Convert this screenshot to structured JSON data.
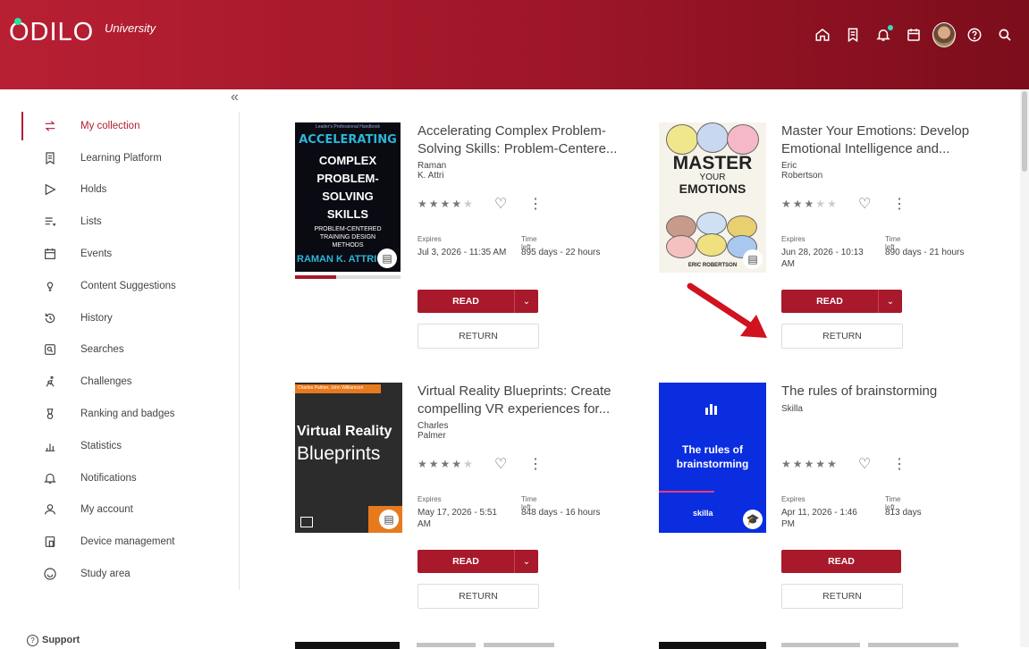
{
  "header": {
    "logo": "ODILO",
    "logo_sub": "University",
    "icons": [
      "home-icon",
      "bookmark-icon",
      "bell-icon",
      "calendar-icon",
      "avatar",
      "help-icon",
      "search-icon"
    ]
  },
  "sidebar": {
    "collapse": "«",
    "items": [
      {
        "label": "My collection",
        "icon": "swap-icon"
      },
      {
        "label": "Learning Platform",
        "icon": "bookmark-icon"
      },
      {
        "label": "Holds",
        "icon": "flag-icon"
      },
      {
        "label": "Lists",
        "icon": "list-icon"
      },
      {
        "label": "Events",
        "icon": "calendar-icon"
      },
      {
        "label": "Content Suggestions",
        "icon": "lightbulb-icon"
      },
      {
        "label": "History",
        "icon": "history-icon"
      },
      {
        "label": "Searches",
        "icon": "search-box-icon"
      },
      {
        "label": "Challenges",
        "icon": "runner-icon"
      },
      {
        "label": "Ranking and badges",
        "icon": "medal-icon"
      },
      {
        "label": "Statistics",
        "icon": "chart-icon"
      },
      {
        "label": "Notifications",
        "icon": "bell-icon"
      },
      {
        "label": "My account",
        "icon": "user-icon"
      },
      {
        "label": "Device management",
        "icon": "device-icon"
      },
      {
        "label": "Study area",
        "icon": "smile-icon"
      }
    ],
    "support": "Support"
  },
  "books": [
    {
      "title": "Accelerating Complex Problem-Solving Skills: Problem-Centere...",
      "author": "Raman K. Attri",
      "rating": 4,
      "expires_label": "Expires",
      "expires": "Jul 3, 2026 - 11:35 AM",
      "timeleft_label": "Time left",
      "timeleft": "895 days - 22 hours",
      "read": "READ",
      "return": "RETURN",
      "progress": 0.39,
      "cover_lines": [
        "ACCELERATING",
        "COMPLEX",
        "PROBLEM-",
        "SOLVING",
        "SKILLS",
        "PROBLEM-CENTERED",
        "TRAINING DESIGN",
        "METHODS",
        "RAMAN K. ATTRI"
      ],
      "cover_top": "Leader's Professional Handbook"
    },
    {
      "title": "Master Your Emotions: Develop Emotional Intelligence and...",
      "author": "Eric Robertson",
      "rating": 3,
      "expires_label": "Expires",
      "expires": "Jun 28, 2026 - 10:13 AM",
      "timeleft_label": "Time left",
      "timeleft": "890 days - 21 hours",
      "read": "READ",
      "return": "RETURN",
      "cover_lines": [
        "MASTER",
        "YOUR",
        "EMOTIONS",
        "ERIC ROBERTSON"
      ]
    },
    {
      "title": "Virtual Reality Blueprints: Create compelling VR experiences for...",
      "author": "Charles Palmer",
      "rating": 4,
      "expires_label": "Expires",
      "expires": "May 17, 2026 - 5:51 AM",
      "timeleft_label": "Time left",
      "timeleft": "848 days - 16 hours",
      "read": "READ",
      "return": "RETURN",
      "cover_lines": [
        "Charles Palmer, John Williamson",
        "Virtual Reality",
        "Blueprints"
      ]
    },
    {
      "title": "The rules of brainstorming",
      "author": "Skilla",
      "rating": 5,
      "expires_label": "Expires",
      "expires": "Apr 11, 2026 - 1:46 PM",
      "timeleft_label": "Time left",
      "timeleft": "813 days",
      "read": "READ",
      "return": "RETURN",
      "cover_lines": [
        "The rules of",
        "brainstorming",
        "skilla"
      ]
    }
  ],
  "colors": {
    "brand": "#a7192b",
    "accent_green": "#2ee0a0",
    "arrow": "#d1121f"
  }
}
